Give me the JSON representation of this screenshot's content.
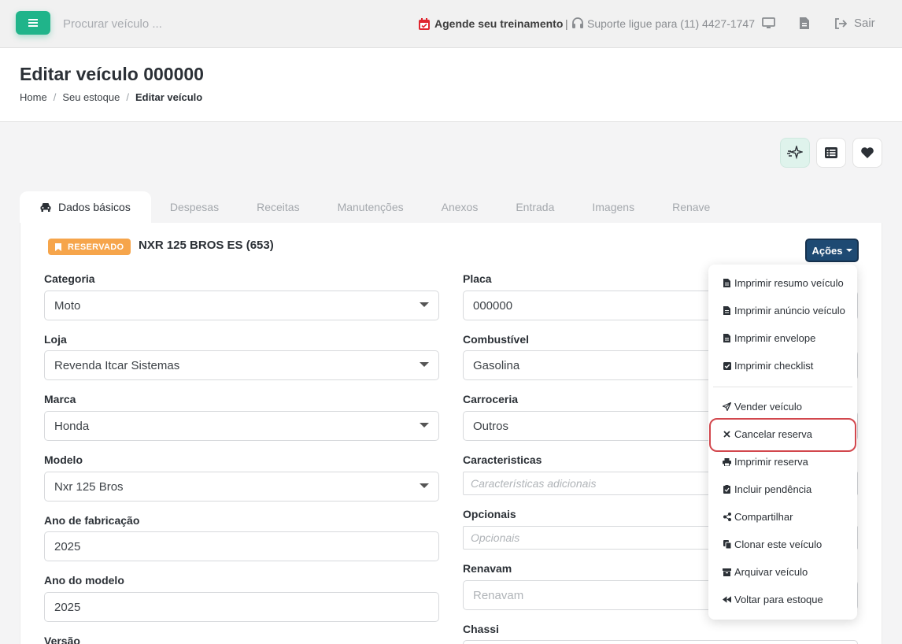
{
  "topbar": {
    "search_placeholder": "Procurar veículo ...",
    "schedule_label": "Agende seu treinamento",
    "separator": "|",
    "support_label": "Suporte ligue para (11) 4427-1747",
    "logout_label": "Sair",
    "icons": [
      "menu-icon",
      "calendar-icon",
      "headset-icon",
      "monitor-icon",
      "file-icon",
      "logout-icon"
    ]
  },
  "header": {
    "title": "Editar veículo 000000",
    "breadcrumbs": [
      "Home",
      "Seu estoque",
      "Editar veículo"
    ],
    "breadcrumb_separator": "/"
  },
  "tabs": [
    "Dados básicos",
    "Despesas",
    "Receitas",
    "Manutenções",
    "Anexos",
    "Entrada",
    "Imagens",
    "Renave"
  ],
  "vehicle": {
    "badge": "RESERVADO",
    "name": "NXR 125 BROS ES (653)",
    "actions_label": "Ações"
  },
  "form": {
    "categoria": {
      "label": "Categoria",
      "value": "Moto"
    },
    "loja": {
      "label": "Loja",
      "value": "Revenda Itcar Sistemas"
    },
    "marca": {
      "label": "Marca",
      "value": "Honda"
    },
    "modelo": {
      "label": "Modelo",
      "value": "Nxr 125 Bros"
    },
    "ano_fabricacao": {
      "label": "Ano de fabricação",
      "value": "2025"
    },
    "ano_modelo": {
      "label": "Ano do modelo",
      "value": "2025"
    },
    "versao": {
      "label": "Versão"
    },
    "placa": {
      "label": "Placa",
      "value": "000000"
    },
    "combustivel": {
      "label": "Combustível",
      "value": "Gasolina"
    },
    "carroceria": {
      "label": "Carroceria",
      "value": "Outros"
    },
    "caracteristicas": {
      "label": "Caracteristicas",
      "placeholder": "Características adicionais"
    },
    "opcionais": {
      "label": "Opcionais",
      "placeholder": "Opcionais"
    },
    "renavam": {
      "label": "Renavam",
      "placeholder": "Renavam"
    },
    "chassi": {
      "label": "Chassi"
    }
  },
  "actions_menu": [
    {
      "label": "Imprimir resumo veículo",
      "icon": "file-text-icon"
    },
    {
      "label": "Imprimir anúncio veículo",
      "icon": "file-text-icon"
    },
    {
      "label": "Imprimir envelope",
      "icon": "file-text-icon"
    },
    {
      "label": "Imprimir checklist",
      "icon": "checkbox-icon"
    },
    {
      "label": "Vender veículo",
      "icon": "send-icon"
    },
    {
      "label": "Cancelar reserva",
      "icon": "close-icon"
    },
    {
      "label": "Imprimir reserva",
      "icon": "printer-icon"
    },
    {
      "label": "Incluir pendência",
      "icon": "clipboard-check-icon"
    },
    {
      "label": "Compartilhar",
      "icon": "share-icon"
    },
    {
      "label": "Clonar este veículo",
      "icon": "copy-icon"
    },
    {
      "label": "Arquivar veículo",
      "icon": "archive-icon"
    },
    {
      "label": "Voltar para estoque",
      "icon": "backward-icon"
    }
  ],
  "colors": {
    "brand_green": "#20b48a",
    "reserved_badge": "#f6a54b",
    "actions_button": "#1e4a73",
    "highlight": "#d2474d",
    "calendar_red": "#e0262f"
  }
}
